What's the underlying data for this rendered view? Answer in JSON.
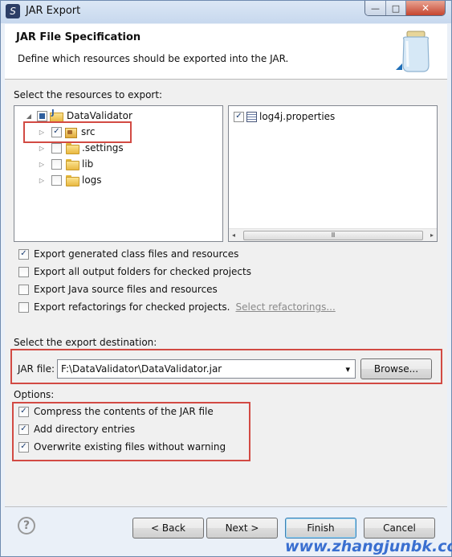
{
  "window": {
    "title": "JAR Export",
    "buttons": {
      "minimize": "—",
      "maximize": "□",
      "close": "✕"
    }
  },
  "header": {
    "title": "JAR File Specification",
    "description": "Define which resources should be exported into the JAR."
  },
  "resources": {
    "label": "Select the resources to export:",
    "tree": [
      {
        "label": "DataValidator",
        "expander": "◢",
        "checked": "partial",
        "icon": "java-project-icon"
      },
      {
        "label": "src",
        "expander": "▷",
        "checked": "true",
        "icon": "source-folder-icon"
      },
      {
        "label": ".settings",
        "expander": "▷",
        "checked": "false",
        "icon": "folder-icon"
      },
      {
        "label": "lib",
        "expander": "▷",
        "checked": "false",
        "icon": "folder-icon"
      },
      {
        "label": "logs",
        "expander": "▷",
        "checked": "false",
        "icon": "folder-icon"
      }
    ],
    "files": [
      {
        "label": "log4j.properties",
        "checked": "true",
        "icon": "properties-file-icon"
      }
    ],
    "scroll": {
      "left": "◂",
      "grip": "III",
      "right": "▸"
    }
  },
  "export_options": [
    {
      "label": "Export generated class files and resources",
      "checked": true
    },
    {
      "label": "Export all output folders for checked projects",
      "checked": false
    },
    {
      "label": "Export Java source files and resources",
      "checked": false
    },
    {
      "label": "Export refactorings for checked projects.",
      "checked": false
    }
  ],
  "select_refactorings_link": "Select refactorings...",
  "destination": {
    "label": "Select the export destination:",
    "jar_file_label": "JAR file:",
    "jar_file_value": "F:\\DataValidator\\DataValidator.jar",
    "dropdown_arrow": "▾",
    "browse_label": "Browse..."
  },
  "options": {
    "label": "Options:",
    "items": [
      {
        "label": "Compress the contents of the JAR file",
        "checked": true
      },
      {
        "label": "Add directory entries",
        "checked": true
      },
      {
        "label": "Overwrite existing files without warning",
        "checked": true
      }
    ]
  },
  "footer": {
    "help": "?",
    "back": "< Back",
    "next": "Next >",
    "finish": "Finish",
    "cancel": "Cancel"
  },
  "watermark": "www.zhangjunbk.com",
  "colors": {
    "highlight_box": "#d24a43",
    "link": "#8a8a8a",
    "watermark": "#3a6fd0"
  }
}
